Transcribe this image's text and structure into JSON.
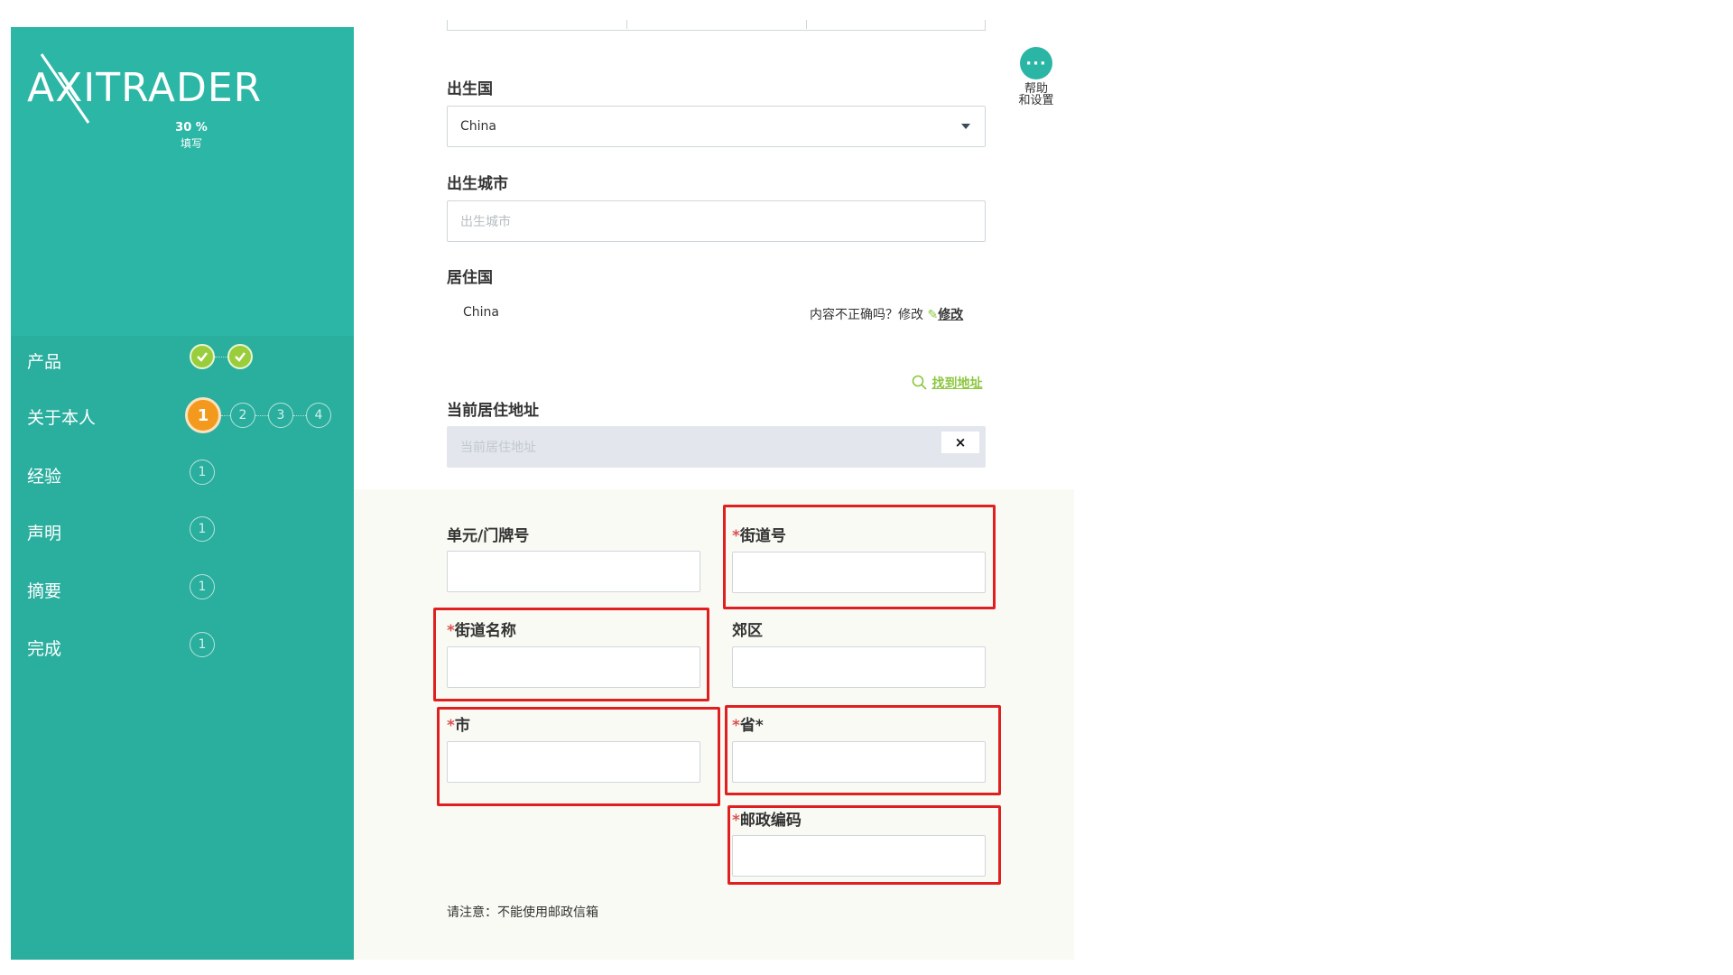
{
  "brand": {
    "logo_text": "AXITRADER",
    "progress_percent": "30 %",
    "progress_label": "填写"
  },
  "steps": [
    {
      "label": "产品",
      "status": "completed"
    },
    {
      "label": "关于本人",
      "status": "active",
      "sub_steps": [
        "1",
        "2",
        "3",
        "4"
      ]
    },
    {
      "label": "经验",
      "status": "pending",
      "badge": "1"
    },
    {
      "label": "声明",
      "status": "pending",
      "badge": "1"
    },
    {
      "label": "摘要",
      "status": "pending",
      "badge": "1"
    },
    {
      "label": "完成",
      "status": "pending",
      "badge": "1"
    }
  ],
  "help": {
    "icon": "ellipsis-icon",
    "label_line1": "帮助",
    "label_line2": "和设置"
  },
  "form": {
    "birth_country": {
      "label": "出生国",
      "value": "China"
    },
    "birth_city": {
      "label": "出生城市",
      "placeholder": "出生城市"
    },
    "residence_country": {
      "label": "居住国",
      "value": "China",
      "incorrect_prompt": "内容不正确吗？修改",
      "edit_link": "修改"
    },
    "find_address_link": "找到地址",
    "current_address": {
      "label": "当前居住地址",
      "placeholder": "当前居住地址",
      "clear": "×"
    },
    "unit_number": {
      "label": "单元/门牌号"
    },
    "street_number": {
      "label": "街道号",
      "required_mark": "*"
    },
    "street_name": {
      "label": "街道名称",
      "required_mark": "*"
    },
    "suburb": {
      "label": "郊区"
    },
    "city": {
      "label": "市",
      "required_mark": "*"
    },
    "province": {
      "label": "省*",
      "required_mark": "*"
    },
    "postcode": {
      "label": "邮政编码",
      "required_mark": "*"
    },
    "note": "请注意：不能使用邮政信箱"
  },
  "colors": {
    "sidebar": "#2ab5a5",
    "active_step": "#f39a1e",
    "completed_step": "#9acd3c",
    "highlight": "#e02020",
    "link": "#8cc63f"
  }
}
